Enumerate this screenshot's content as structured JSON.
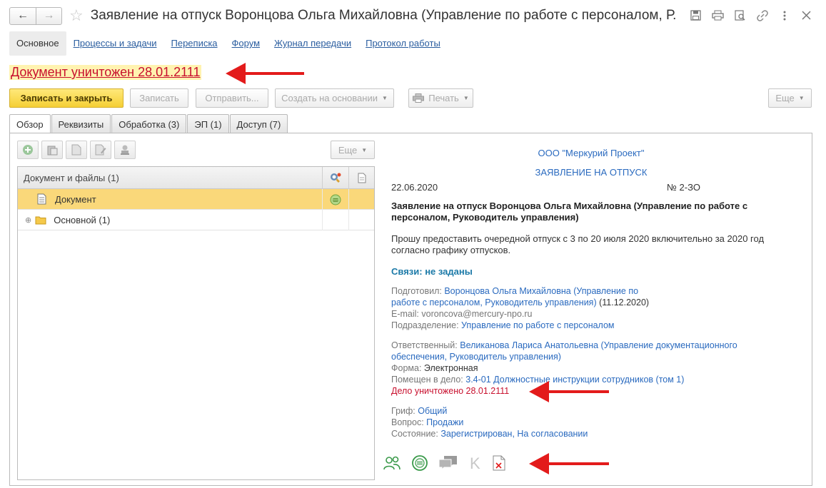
{
  "window": {
    "title": "Заявление на отпуск Воронцова Ольга Михайловна (Управление по работе с персоналом, Р..."
  },
  "sections": [
    {
      "label": "Основное"
    },
    {
      "label": "Процессы и задачи"
    },
    {
      "label": "Переписка"
    },
    {
      "label": "Форум"
    },
    {
      "label": "Журнал передачи"
    },
    {
      "label": "Протокол работы"
    }
  ],
  "destroyed_banner": "Документ уничтожен 28.01.2111",
  "toolbar": {
    "save_close": "Записать и закрыть",
    "save": "Записать",
    "send": "Отправить...",
    "create_based": "Создать на основании",
    "print": "Печать",
    "more": "Еще"
  },
  "tabs": [
    {
      "label": "Обзор"
    },
    {
      "label": "Реквизиты"
    },
    {
      "label": "Обработка (3)"
    },
    {
      "label": "ЭП (1)"
    },
    {
      "label": "Доступ (7)"
    }
  ],
  "files": {
    "more": "Еще",
    "header": "Документ и файлы (1)",
    "rows": [
      {
        "label": "Документ"
      },
      {
        "label": "Основной (1)"
      }
    ]
  },
  "preview": {
    "org": "ООО \"Меркурий Проект\"",
    "doc_type": "ЗАЯВЛЕНИЕ НА ОТПУСК",
    "date": "22.06.2020",
    "number": "№ 2-ЗО",
    "subject_line1": "Заявление на отпуск Воронцова Ольга Михайловна (Управление по работе с",
    "subject_line2": "персоналом, Руководитель управления)",
    "body_line1": "Прошу предоставить очередной отпуск с 3 по 20 июля 2020 включительно за 2020 год",
    "body_line2": "согласно графику отпусков.",
    "links": "Связи: не заданы",
    "prepared_label": "Подготовил:",
    "prepared_name1": "Воронцова Ольга Михайловна (Управление по",
    "prepared_name2": "работе с персоналом, Руководитель управления)",
    "prepared_date": "(11.12.2020)",
    "email_label": "E-mail:",
    "email": "voroncova@mercury-npo.ru",
    "dept_label": "Подразделение:",
    "dept": "Управление по работе с персоналом",
    "resp_label": "Ответственный:",
    "resp1": "Великанова Лариса Анатольевна (Управление документационного",
    "resp2": "обеспечения, Руководитель управления)",
    "form_label": "Форма:",
    "form": "Электронная",
    "case_label": "Помещен в дело:",
    "case": "3.4-01 Должностные инструкции сотрудников (том 1)",
    "case_destroyed": "Дело уничтожено 28.01.2111",
    "grif_label": "Гриф:",
    "grif": "Общий",
    "question_label": "Вопрос:",
    "question": "Продажи",
    "state_label": "Состояние:",
    "state": "Зарегистрирован, На согласовании"
  },
  "colors": {
    "accent_red": "#e31b1b",
    "link_blue": "#2a6abf",
    "selection": "#fad87a",
    "primary_button": "#f5cf35"
  }
}
